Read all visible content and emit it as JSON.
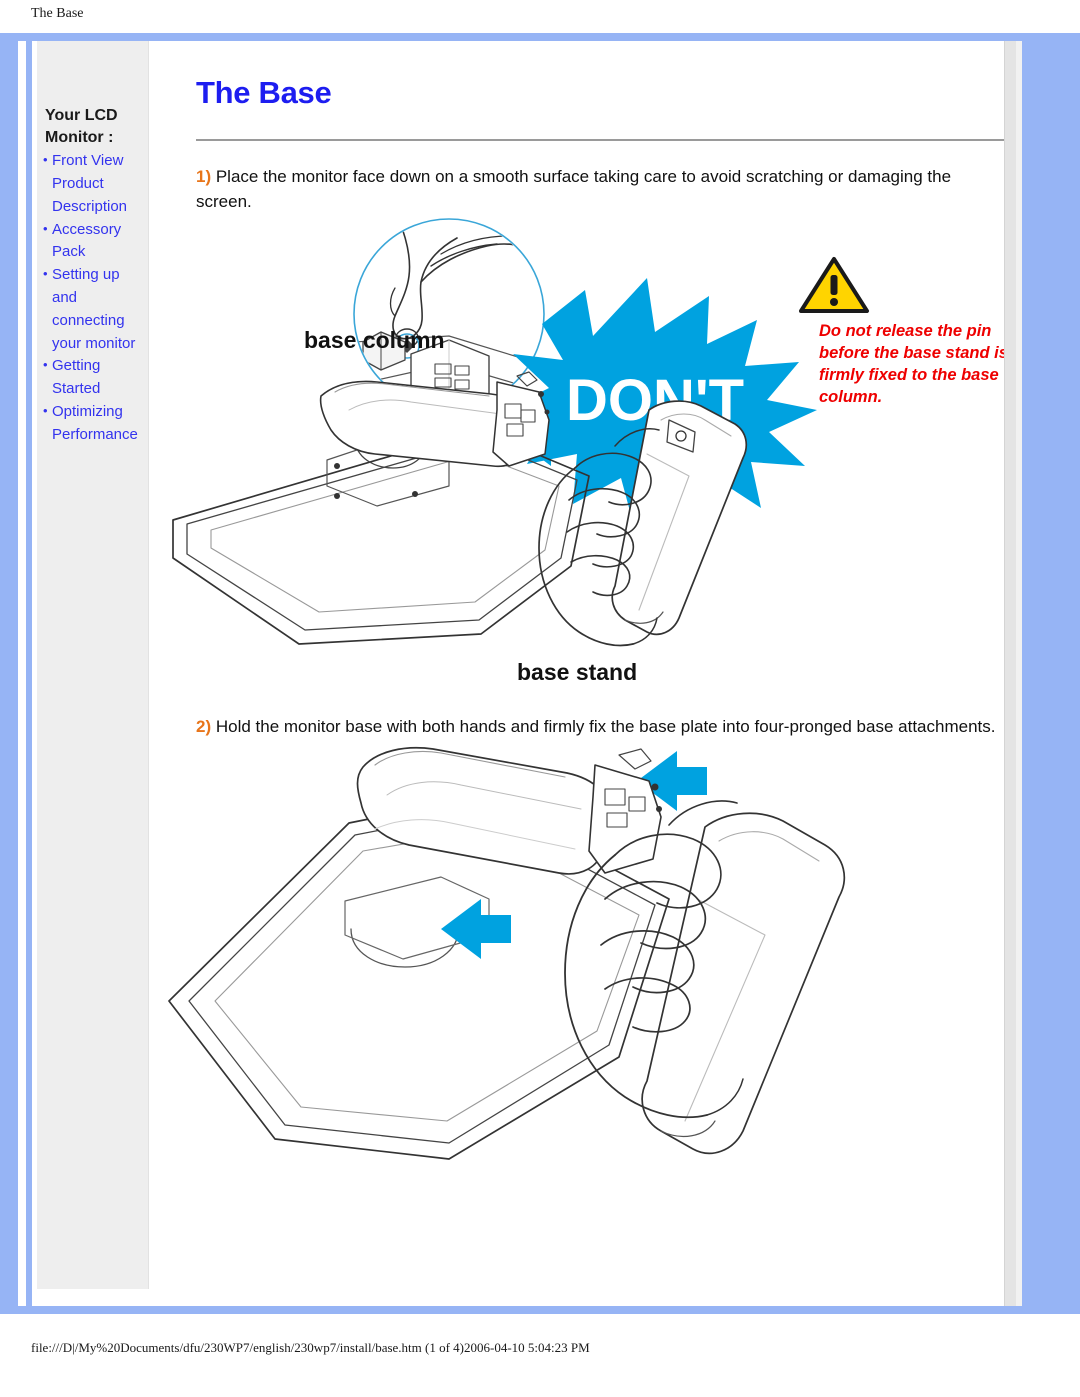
{
  "print_header": {
    "title": "The Base"
  },
  "sidebar": {
    "heading": "Your LCD Monitor :",
    "items": [
      {
        "label": "Front View Product Description"
      },
      {
        "label": "Accessory Pack"
      },
      {
        "label": "Setting up and connecting your monitor"
      },
      {
        "label": "Getting Started"
      },
      {
        "label": "Optimizing Performance"
      }
    ]
  },
  "main": {
    "title": "The Base",
    "steps": [
      {
        "number": "1)",
        "text": " Place the monitor face down on a smooth surface taking care to avoid scratching or damaging the screen."
      },
      {
        "number": "2)",
        "text": " Hold the monitor base with both hands and firmly fix the base plate into four-pronged base attachments."
      }
    ],
    "figure1": {
      "label_base_column": "base column",
      "label_base_stand": "base stand",
      "dont_badge": "DON'T"
    },
    "warning": {
      "text": "Do not release the pin before the base stand is firmly fixed to the base column."
    }
  },
  "footer": {
    "url": "file:///D|/My%20Documents/dfu/230WP7/english/230wp7/install/base.htm (1 of 4)2006-04-10 5:04:23 PM"
  },
  "colors": {
    "frame_blue": "#96b4f5",
    "sidebar_bg": "#eeeeee",
    "link_blue": "#3333ee",
    "title_blue": "#1d1df0",
    "step_orange": "#e8751a",
    "warning_red": "#ee0000",
    "badge_cyan": "#00a2e0",
    "arrow_cyan": "#00a2e0",
    "warn_icon_yellow": "#ffd400"
  }
}
